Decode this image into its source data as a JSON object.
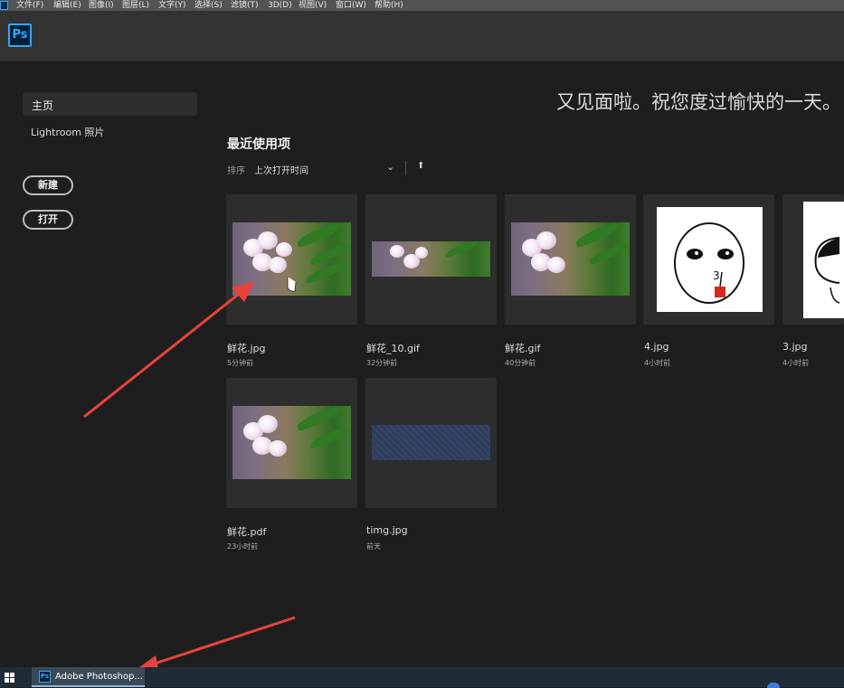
{
  "menu": [
    "文件(F)",
    "编辑(E)",
    "图像(I)",
    "图层(L)",
    "文字(Y)",
    "选择(S)",
    "滤镜(T)",
    "3D(D)",
    "视图(V)",
    "窗口(W)",
    "帮助(H)"
  ],
  "app_logo": "Ps",
  "sidebar": {
    "home": "主页",
    "lightroom": "Lightroom 照片",
    "new_button": "新建",
    "open_button": "打开"
  },
  "greeting": "又见面啦。祝您度过愉快的一天。",
  "recent": {
    "title": "最近使用项",
    "sort_label": "排序",
    "sort_value": "上次打开时间",
    "files": [
      {
        "name": "鲜花.jpg",
        "time": "5分钟前",
        "thumb": "flower"
      },
      {
        "name": "鲜花_10.gif",
        "time": "32分钟前",
        "thumb": "flower-strip"
      },
      {
        "name": "鲜花.gif",
        "time": "40分钟前",
        "thumb": "flower"
      },
      {
        "name": "4.jpg",
        "time": "4小时前",
        "thumb": "cartoon-face"
      },
      {
        "name": "3.jpg",
        "time": "4小时前",
        "thumb": "cartoon-face-2"
      },
      {
        "name": "鲜花.pdf",
        "time": "23小时前",
        "thumb": "flower"
      },
      {
        "name": "timg.jpg",
        "time": "前天",
        "thumb": "blue-noise"
      }
    ]
  },
  "taskbar": {
    "ps_icon": "Ps",
    "app_label": "Adobe Photoshop..."
  },
  "colors": {
    "background": "#1e1e1f",
    "topbar": "#323232",
    "card": "#2d2d2d",
    "ps_blue": "#31a8ff",
    "annotation_arrow": "#e8423a"
  }
}
